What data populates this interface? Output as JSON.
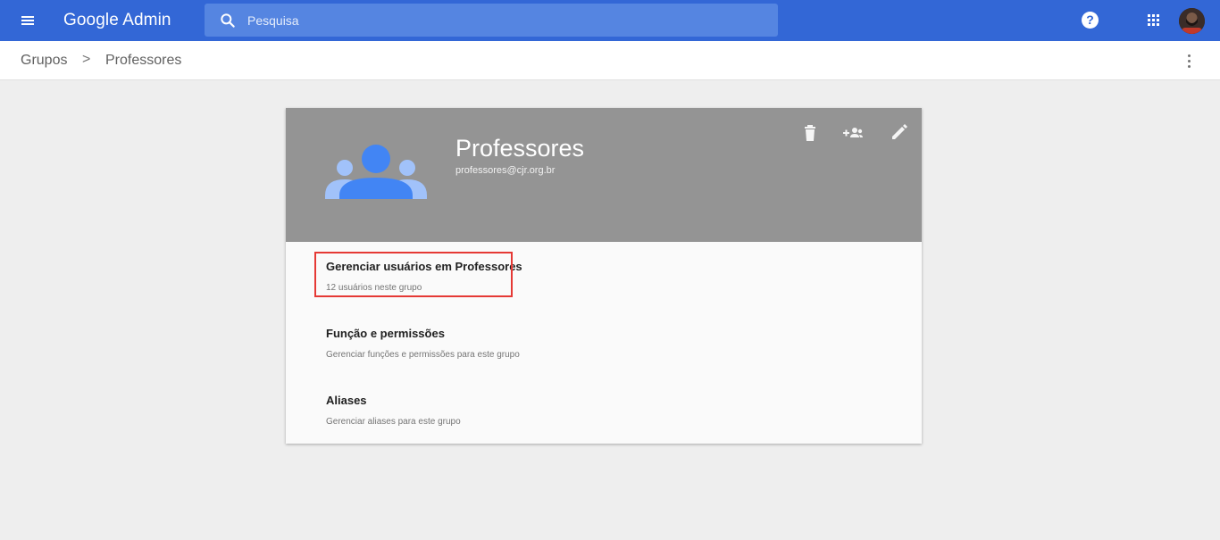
{
  "appbar": {
    "logo_google": "Google",
    "logo_admin": "Admin",
    "search_placeholder": "Pesquisa",
    "help_glyph": "?",
    "icons": [
      "menu-icon",
      "search-icon",
      "help-icon",
      "apps-grid-icon",
      "avatar"
    ]
  },
  "breadcrumb": {
    "items": [
      "Grupos",
      "Professores"
    ],
    "separator": ">"
  },
  "group": {
    "name": "Professores",
    "email": "professores@cjr.org.br",
    "header_actions": [
      "delete-icon",
      "add-user-icon",
      "edit-icon"
    ]
  },
  "sections": [
    {
      "title": "Gerenciar usuários em Professores",
      "subtitle": "12 usuários neste grupo",
      "highlighted": true
    },
    {
      "title": "Função e permissões",
      "subtitle": "Gerenciar funções e permissões para este grupo"
    },
    {
      "title": "Aliases",
      "subtitle": "Gerenciar aliases para este grupo"
    }
  ],
  "colors": {
    "appbar": "#3367d6",
    "search_bg": "#5585e1",
    "card_header": "#949494",
    "group_icon_blue": "#4285f4",
    "group_icon_light_blue": "#a1c2fa",
    "highlight_border": "#e53935"
  }
}
